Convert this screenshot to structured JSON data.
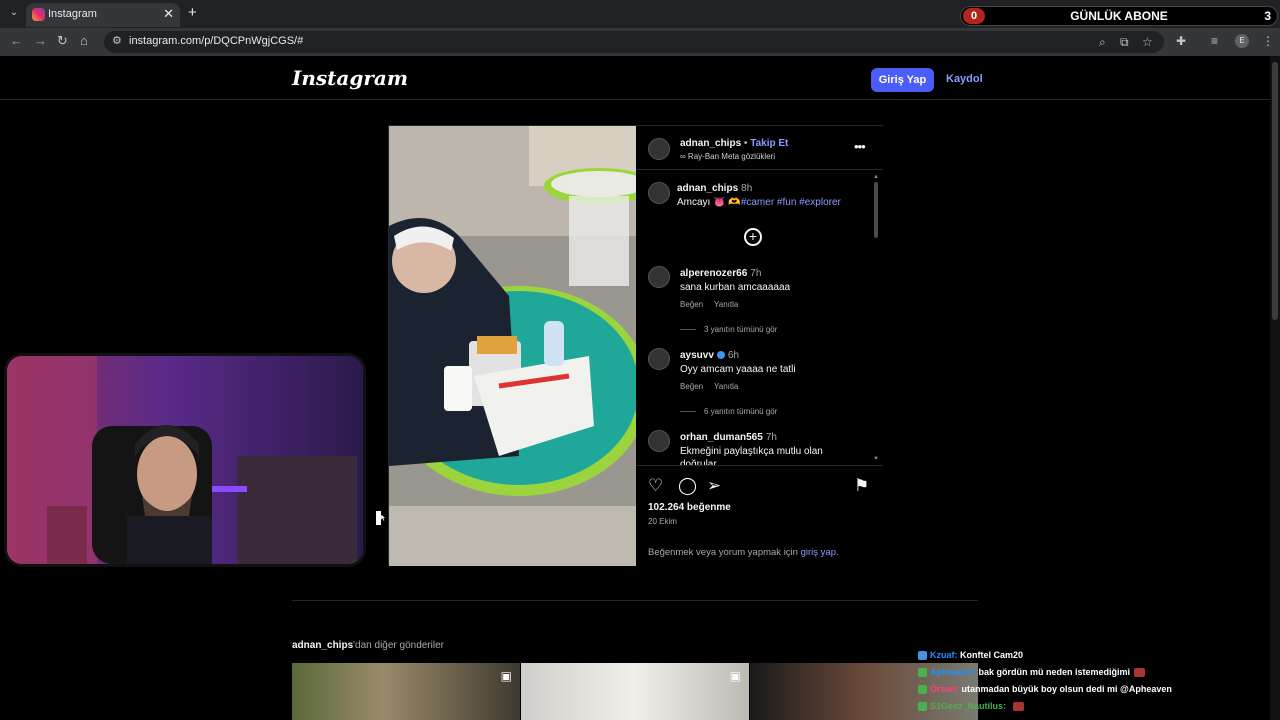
{
  "browser": {
    "tab_title": "Instagram",
    "tab_close": "✕",
    "new_tab": "+",
    "url": "instagram.com/p/DQCPnWgjCGS/#"
  },
  "overlay": {
    "left_count": "0",
    "title": "GÜNLÜK ABONE",
    "right_count": "3"
  },
  "instagram": {
    "logo": "Instagram",
    "login_button": "Giriş Yap",
    "signup_link": "Kaydol"
  },
  "post": {
    "author": "adnan_chips",
    "follow_dot": "•",
    "follow": "Takip Et",
    "device": "∞ Ray-Ban Meta gözlükleri",
    "more": "•••",
    "caption": {
      "user": "adnan_chips",
      "time": "8h",
      "text": "Amcayı 👅 🫶",
      "hashtags": "#camer #fun #explorer"
    },
    "comments": [
      {
        "user": "alperenozer66",
        "time": "7h",
        "text": "sana kurban amcaaaaaa",
        "like": "Beğen",
        "reply": "Yanıtla",
        "replies": "3 yanıtın tümünü gör"
      },
      {
        "user": "aysuvv",
        "time": "6h",
        "text": "Oyy amcam yaaaa ne tatli",
        "like": "Beğen",
        "reply": "Yanıtla",
        "replies": "6 yanıtın tümünü gör"
      },
      {
        "user": "orhan_duman565",
        "time": "7h",
        "text": "Ekmeğini paylaştıkça mutlu olan doğrular"
      }
    ],
    "likes": "102.264 beğenme",
    "date": "20 Ekim",
    "login_note_prefix": "Beğenmek veya yorum yapmak için",
    "login_note_link": "giriş yap",
    "login_note_suffix": "."
  },
  "more_posts": {
    "user": "adnan_chips",
    "suffix": "'dan diğer gönderiler"
  },
  "chat": [
    {
      "user": "Kzuaf:",
      "message": "Konftel Cam20",
      "badge_color": "#4a90e2"
    },
    {
      "user": "Apheaven:",
      "message": "bak gördün mü neden istemediğimi",
      "badge_color": "#4caf50"
    },
    {
      "user": "Orsan:",
      "message": "utanmadan büyük boy olsun dedi mi @Apheaven",
      "badge_color": "#4caf50"
    },
    {
      "user": "S1Geez_Nautilus:",
      "message": "",
      "badge_color": "#4caf50"
    }
  ]
}
